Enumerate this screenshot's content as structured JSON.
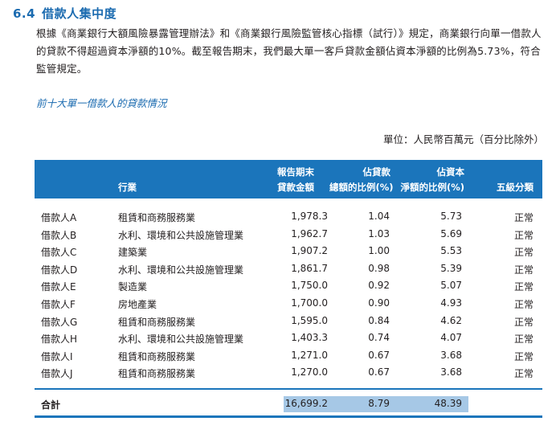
{
  "section": {
    "number": "6.4",
    "title": "借款人集中度"
  },
  "paragraph": "根據《商業銀行大額風險暴露管理辦法》和《商業銀行風險監管核心指標（試行）》規定，商業銀行向單一借款人的貸款不得超過資本淨額的10%。截至報告期末，我們最大單一客戶貸款金額佔資本淨額的比例為5.73%，符合監管規定。",
  "subtitle": "前十大單一借款人的貸款情況",
  "unit": "單位：人民幣百萬元（百分比除外）",
  "table": {
    "headers": {
      "industry": "行業",
      "amount_1": "報告期末",
      "amount_2": "貸款金額",
      "pct_total_1": "佔貸款",
      "pct_total_2": "總額的比例(%)",
      "pct_net_1": "佔資本",
      "pct_net_2": "淨額的比例(%)",
      "classification": "五級分類"
    },
    "rows": [
      {
        "name": "借款人A",
        "industry": "租賃和商務服務業",
        "amount": "1,978.3",
        "pct_total": "1.04",
        "pct_net": "5.73",
        "class": "正常"
      },
      {
        "name": "借款人B",
        "industry": "水利、環境和公共設施管理業",
        "amount": "1,962.7",
        "pct_total": "1.03",
        "pct_net": "5.69",
        "class": "正常"
      },
      {
        "name": "借款人C",
        "industry": "建築業",
        "amount": "1,907.2",
        "pct_total": "1.00",
        "pct_net": "5.53",
        "class": "正常"
      },
      {
        "name": "借款人D",
        "industry": "水利、環境和公共設施管理業",
        "amount": "1,861.7",
        "pct_total": "0.98",
        "pct_net": "5.39",
        "class": "正常"
      },
      {
        "name": "借款人E",
        "industry": "製造業",
        "amount": "1,750.0",
        "pct_total": "0.92",
        "pct_net": "5.07",
        "class": "正常"
      },
      {
        "name": "借款人F",
        "industry": "房地產業",
        "amount": "1,700.0",
        "pct_total": "0.90",
        "pct_net": "4.93",
        "class": "正常"
      },
      {
        "name": "借款人G",
        "industry": "租賃和商務服務業",
        "amount": "1,595.0",
        "pct_total": "0.84",
        "pct_net": "4.62",
        "class": "正常"
      },
      {
        "name": "借款人H",
        "industry": "水利、環境和公共設施管理業",
        "amount": "1,403.3",
        "pct_total": "0.74",
        "pct_net": "4.07",
        "class": "正常"
      },
      {
        "name": "借款人I",
        "industry": "租賃和商務服務業",
        "amount": "1,271.0",
        "pct_total": "0.67",
        "pct_net": "3.68",
        "class": "正常"
      },
      {
        "name": "借款人J",
        "industry": "租賃和商務服務業",
        "amount": "1,270.0",
        "pct_total": "0.67",
        "pct_net": "3.68",
        "class": "正常"
      }
    ],
    "total": {
      "label": "合計",
      "amount": "16,699.2",
      "pct_total": "8.79",
      "pct_net": "48.39"
    }
  },
  "colors": {
    "accent": "#1b75bb",
    "title": "#1b6bb0",
    "highlight": "#a6c8e6"
  }
}
